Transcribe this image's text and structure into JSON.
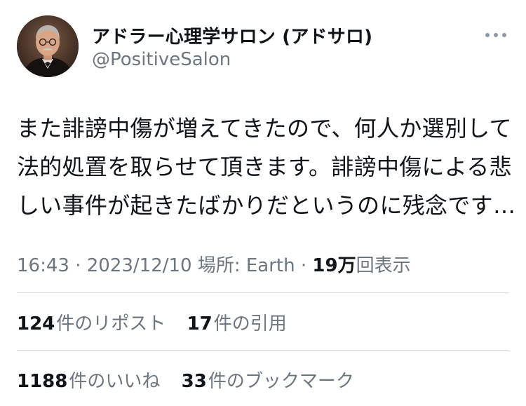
{
  "author": {
    "display_name": "アドラー心理学サロン (アドサロ)",
    "handle": "@PositiveSalon"
  },
  "more_icon": "more-horizontal-icon",
  "tweet": {
    "lines": [
      "また誹謗中傷が増えてきたので、何人か選別して",
      "法的処置を取らせて頂きます。誹謗中傷による悲",
      "しい事件が起きたばかりだというのに残念です…"
    ]
  },
  "meta": {
    "time": "16:43",
    "sep1": " · ",
    "date": "2023/12/10",
    "location": " 場所: Earth",
    "sep2": " · ",
    "views_count": "19万",
    "views_label": "回表示"
  },
  "stats": {
    "reposts_count": "124",
    "reposts_label": "件のリポスト",
    "quotes_count": "17",
    "quotes_label": "件の引用",
    "likes_count": "1188",
    "likes_label": "件のいいね",
    "bookmarks_count": "33",
    "bookmarks_label": "件のブックマーク"
  },
  "colors": {
    "text_primary": "#0f1419",
    "text_secondary": "#6b7681",
    "divider": "#cfd9de",
    "background": "#ffffff"
  }
}
